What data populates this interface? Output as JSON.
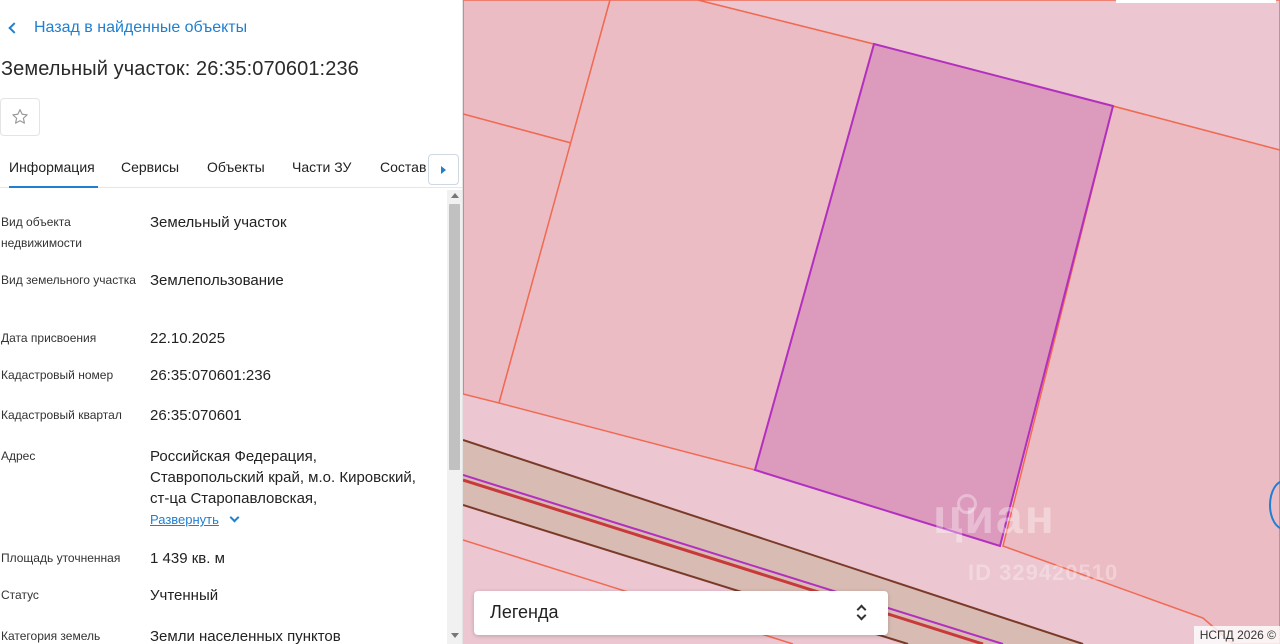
{
  "panel": {
    "back_label": "Назад в найденные объекты",
    "title": "Земельный участок: 26:35:070601:236",
    "favorite_icon": "star-outline-icon",
    "tabs": [
      {
        "label": "Информация",
        "active": true
      },
      {
        "label": "Сервисы",
        "active": false
      },
      {
        "label": "Объекты",
        "active": false
      },
      {
        "label": "Части ЗУ",
        "active": false
      },
      {
        "label": "Состав",
        "active": false
      }
    ],
    "properties": [
      {
        "label": "Вид объекта недвижимости",
        "value": "Земельный участок"
      },
      {
        "label": "Вид земельного участка",
        "value": "Землепользование"
      },
      {
        "label": "Дата присвоения",
        "value": "22.10.2025"
      },
      {
        "label": "Кадастровый номер",
        "value": "26:35:070601:236"
      },
      {
        "label": "Кадастровый квартал",
        "value": "26:35:070601"
      },
      {
        "label": "Адрес",
        "value": "Российская Федерация, Ставропольский край, м.о. Кировский, ст-ца Старопавловская,",
        "expand": "Развернуть"
      },
      {
        "label": "Площадь уточненная",
        "value": "1 439 кв. м"
      },
      {
        "label": "Статус",
        "value": "Учтенный"
      },
      {
        "label": "Категория земель",
        "value": "Земли населенных пунктов"
      }
    ]
  },
  "map": {
    "legend_label": "Легенда",
    "attribution": "НСПД 2026 ©",
    "watermark": "циан",
    "watermark_id": "ID 329420510",
    "colors": {
      "background": "#ecc6d0",
      "parcel_fill": "#ecbcc4",
      "parcel_border": "#f06a52",
      "selected_fill": "#dc9abc",
      "selected_border": "#b22fbf",
      "road_fill": "#d8bcb4",
      "road_line": "#7a3a28",
      "road_red": "#c83a3a"
    }
  }
}
